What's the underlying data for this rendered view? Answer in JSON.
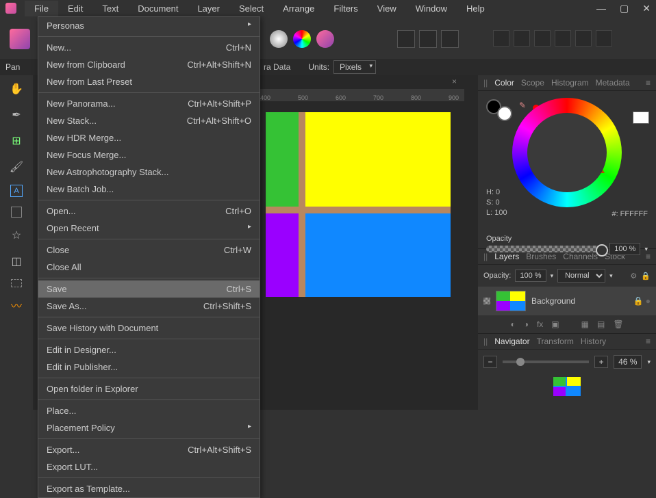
{
  "menubar": {
    "items": [
      "File",
      "Edit",
      "Text",
      "Document",
      "Layer",
      "Select",
      "Arrange",
      "Filters",
      "View",
      "Window",
      "Help"
    ]
  },
  "dropdown": {
    "groups": [
      [
        {
          "label": "Personas",
          "sub": true
        }
      ],
      [
        {
          "label": "New...",
          "shortcut": "Ctrl+N"
        },
        {
          "label": "New from Clipboard",
          "shortcut": "Ctrl+Alt+Shift+N"
        },
        {
          "label": "New from Last Preset"
        }
      ],
      [
        {
          "label": "New Panorama...",
          "shortcut": "Ctrl+Alt+Shift+P"
        },
        {
          "label": "New Stack...",
          "shortcut": "Ctrl+Alt+Shift+O"
        },
        {
          "label": "New HDR Merge..."
        },
        {
          "label": "New Focus Merge..."
        },
        {
          "label": "New Astrophotography Stack..."
        },
        {
          "label": "New Batch Job..."
        }
      ],
      [
        {
          "label": "Open...",
          "shortcut": "Ctrl+O"
        },
        {
          "label": "Open Recent",
          "sub": true
        }
      ],
      [
        {
          "label": "Close",
          "shortcut": "Ctrl+W"
        },
        {
          "label": "Close All"
        }
      ],
      [
        {
          "label": "Save",
          "shortcut": "Ctrl+S",
          "hi": true
        },
        {
          "label": "Save As...",
          "shortcut": "Ctrl+Shift+S"
        }
      ],
      [
        {
          "label": "Save History with Document"
        }
      ],
      [
        {
          "label": "Edit in Designer..."
        },
        {
          "label": "Edit in Publisher..."
        }
      ],
      [
        {
          "label": "Open folder in Explorer"
        }
      ],
      [
        {
          "label": "Place..."
        },
        {
          "label": "Placement Policy",
          "sub": true
        }
      ],
      [
        {
          "label": "Export...",
          "shortcut": "Ctrl+Alt+Shift+S"
        },
        {
          "label": "Export LUT..."
        }
      ],
      [
        {
          "label": "Export as Template..."
        }
      ]
    ]
  },
  "context": {
    "pan_label": "Pan",
    "raw_label": "ra Data",
    "units_label": "Units:",
    "units_value": "Pixels"
  },
  "ruler": [
    "400",
    "500",
    "600",
    "700",
    "800",
    "900"
  ],
  "color_panel": {
    "tabs": [
      "Color",
      "Scope",
      "Histogram",
      "Metadata"
    ],
    "hsl": {
      "h": "H: 0",
      "s": "S: 0",
      "l": "L: 100"
    },
    "hex": "#: FFFFFF",
    "opacity_label": "Opacity",
    "opacity_value": "100 %"
  },
  "layers_panel": {
    "tabs": [
      "Layers",
      "Brushes",
      "Channels",
      "Stock"
    ],
    "opacity_label": "Opacity:",
    "opacity_value": "100 %",
    "blend_mode": "Normal",
    "layer_name": "Background"
  },
  "nav_panel": {
    "tabs": [
      "Navigator",
      "Transform",
      "History"
    ],
    "zoom": "46 %"
  }
}
